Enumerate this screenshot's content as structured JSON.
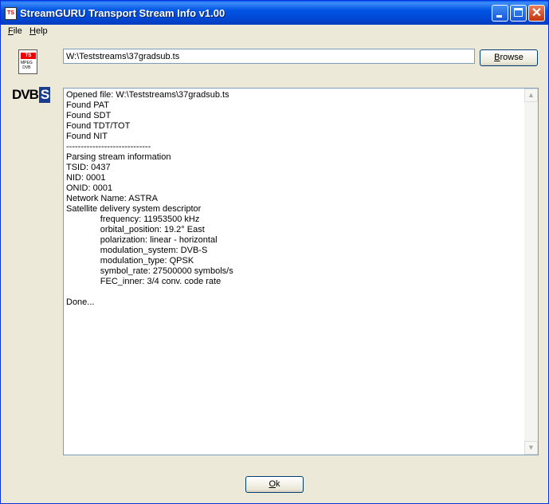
{
  "window": {
    "title": "StreamGURU Transport Stream Info v1.00",
    "app_icon_text": "TS",
    "close_glyph": "✕"
  },
  "menu": {
    "file_hotkey": "F",
    "file_rest": "ile",
    "help_hotkey": "H",
    "help_rest": "elp"
  },
  "logos": {
    "ts_tag": "TS",
    "ts_sub": "MPEG\nDVB",
    "dvb_text": "DVB",
    "dvb_s": "S"
  },
  "path": {
    "value": "W:\\Teststreams\\37gradsub.ts"
  },
  "buttons": {
    "browse_hotkey": "B",
    "browse_rest": "rowse",
    "ok_hotkey": "O",
    "ok_rest": "k"
  },
  "log": {
    "text": "Opened file: W:\\Teststreams\\37gradsub.ts\nFound PAT\nFound SDT\nFound TDT/TOT\nFound NIT\n-----------------------------\nParsing stream information\nTSID: 0437\nNID: 0001\nONID: 0001\nNetwork Name: ASTRA\nSatellite delivery system descriptor\n              frequency: 11953500 kHz\n              orbital_position: 19.2° East\n              polarization: linear - horizontal\n              modulation_system: DVB-S\n              modulation_type: QPSK\n              symbol_rate: 27500000 symbols/s\n              FEC_inner: 3/4 conv. code rate\n\nDone..."
  },
  "scrollbar": {
    "up_arrow": "▲",
    "down_arrow": "▼"
  }
}
